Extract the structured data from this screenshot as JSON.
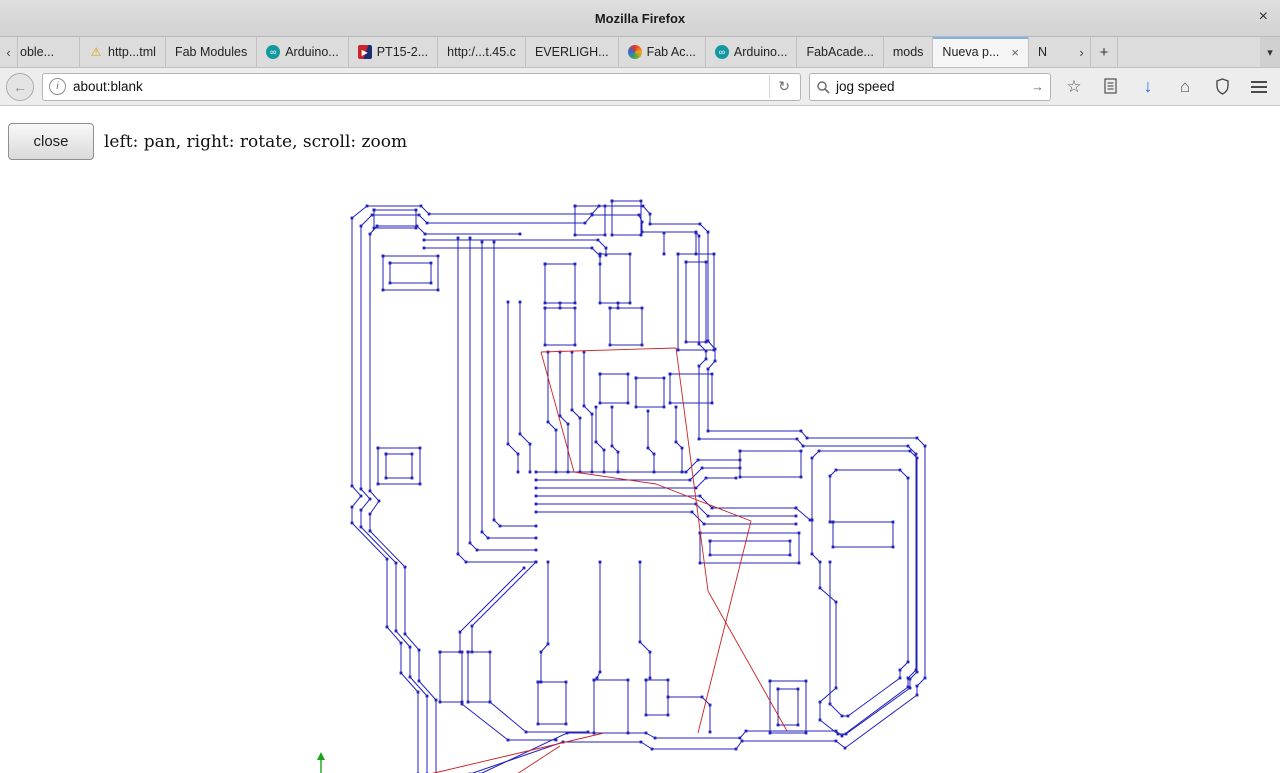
{
  "window": {
    "title": "Mozilla Firefox",
    "close_icon": "×"
  },
  "tabbar": {
    "scroll_left": "‹",
    "scroll_right": "›",
    "new_tab": "+",
    "list_tabs": "▾",
    "tabs": [
      {
        "label": "oble..."
      },
      {
        "label": "http...tml",
        "icon": "warning-icon"
      },
      {
        "label": "Fab Modules"
      },
      {
        "label": "Arduino...",
        "icon": "arduino-icon"
      },
      {
        "label": "PT15-2...",
        "icon": "pt-icon"
      },
      {
        "label": "http:/...t.45.c"
      },
      {
        "label": "EVERLIGH..."
      },
      {
        "label": "Fab Ac...",
        "icon": "globe-icon"
      },
      {
        "label": "Arduino...",
        "icon": "arduino-icon"
      },
      {
        "label": "FabAcade..."
      },
      {
        "label": "mods"
      },
      {
        "label": "Nueva p...",
        "active": true,
        "close_icon": "×"
      },
      {
        "label": "N"
      }
    ]
  },
  "navbar": {
    "back_icon": "←",
    "info_icon": "i",
    "url": "about:blank",
    "reload_icon": "↻",
    "search_value": "jog speed",
    "go_icon": "→",
    "star_icon": "☆",
    "download_icon": "↓",
    "home_icon": "⌂"
  },
  "content": {
    "close_button": "close",
    "instructions": "left: pan, right: rotate, scroll: zoom"
  },
  "colors": {
    "trace": "#2323bb",
    "rapid": "#cc2222",
    "origin": "#19a319"
  }
}
